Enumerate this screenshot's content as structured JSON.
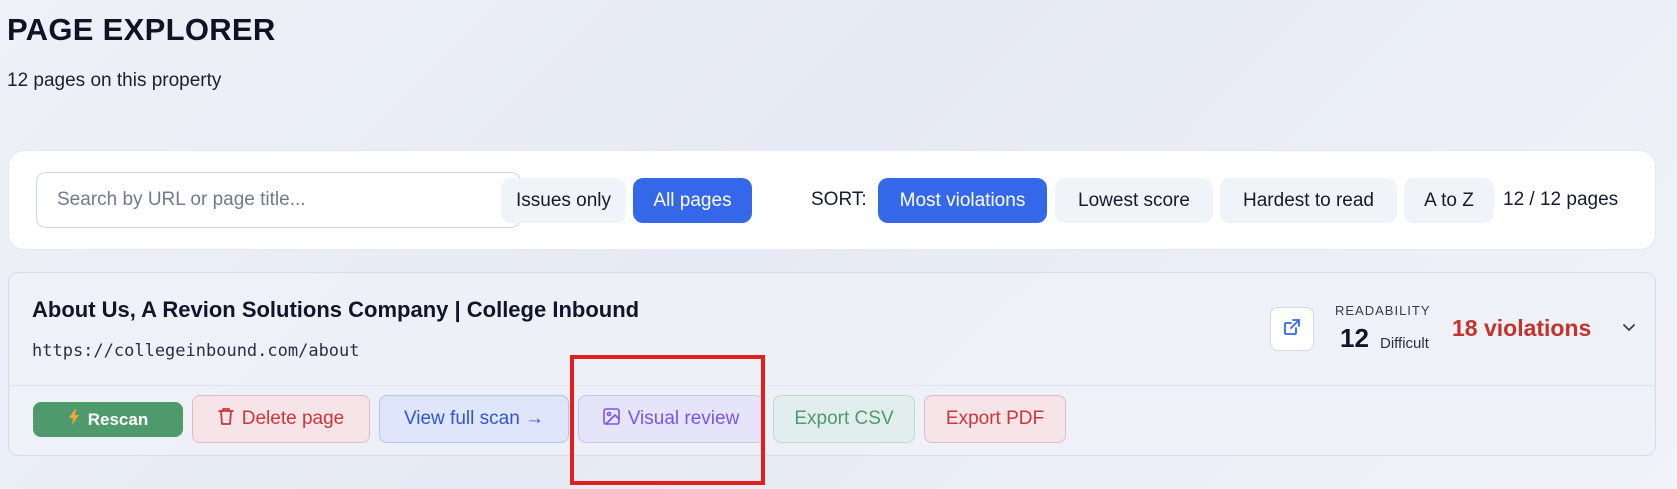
{
  "header": {
    "title": "PAGE EXPLORER",
    "subtitle": "12 pages on this property"
  },
  "toolbar": {
    "search_placeholder": "Search by URL or page title...",
    "search_value": "",
    "filters": [
      {
        "label": "Issues only",
        "active": false
      },
      {
        "label": "All pages",
        "active": true
      }
    ],
    "sort_label": "SORT:",
    "sort_options": [
      {
        "label": "Most violations",
        "active": true
      },
      {
        "label": "Lowest score",
        "active": false
      },
      {
        "label": "Hardest to read",
        "active": false
      },
      {
        "label": "A to Z",
        "active": false
      }
    ],
    "count": "12 / 12 pages"
  },
  "page_card": {
    "title": "About Us, A Revion Solutions Company | College Inbound",
    "url": "https://collegeinbound.com/about",
    "readability_label": "READABILITY",
    "readability_score": "12",
    "readability_level": "Difficult",
    "violations": "18 violations",
    "actions": {
      "rescan": "Rescan",
      "delete": "Delete page",
      "view_full_scan": "View full scan →",
      "visual_review": "Visual review",
      "export_csv": "Export CSV",
      "export_pdf": "Export PDF"
    }
  },
  "icons": [
    "external-link-icon",
    "chevron-down-icon",
    "bolt-icon",
    "trash-icon",
    "image-icon"
  ],
  "colors": {
    "primary": "#3468e8",
    "danger": "#c4322b",
    "success": "#4e9a6c",
    "purple": "#7a55e6",
    "highlight": "#e41d1d"
  }
}
